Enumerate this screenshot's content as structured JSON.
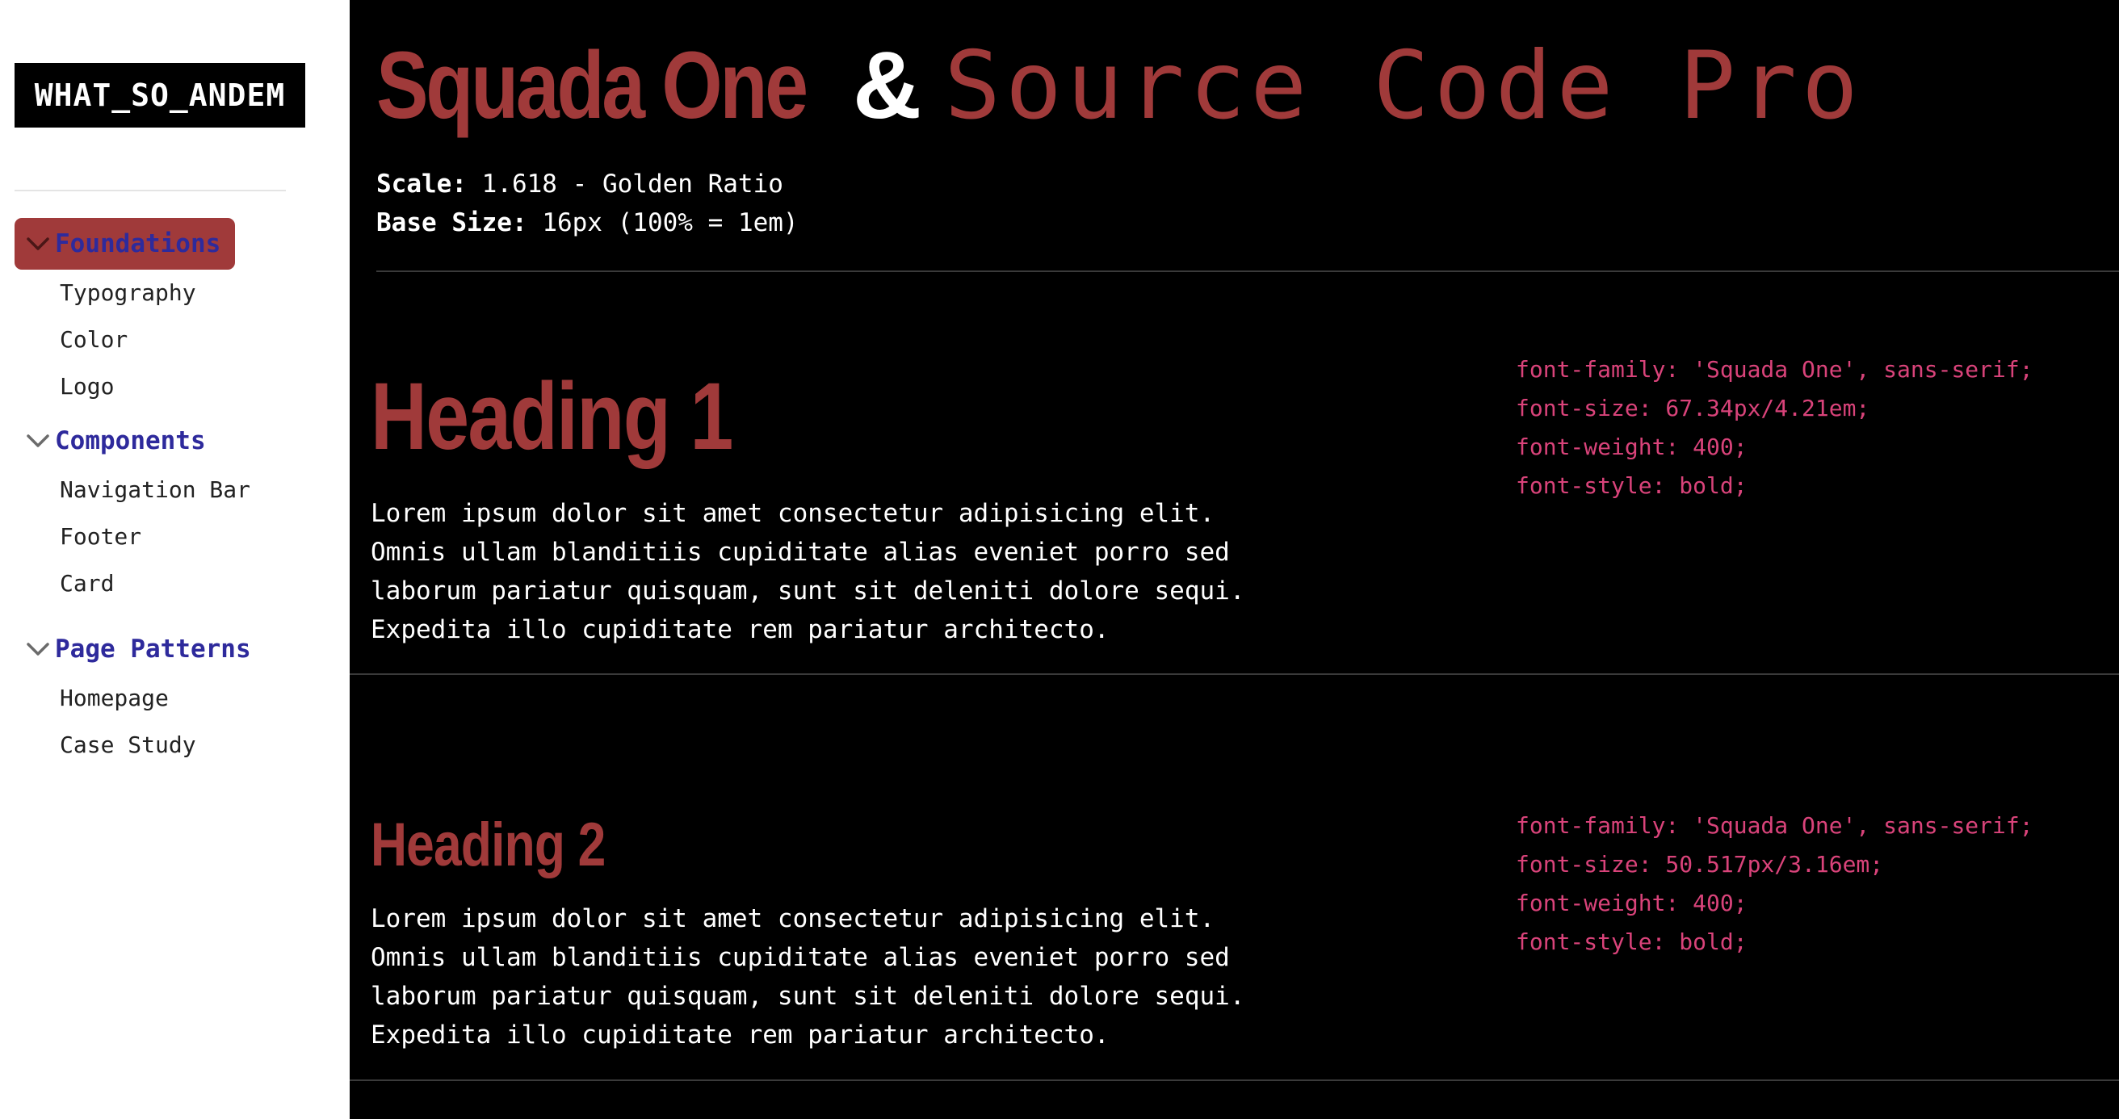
{
  "sidebar": {
    "logo": "WHAT_SO_ANDEM",
    "groups": [
      {
        "label": "Foundations",
        "items": [
          "Typography",
          "Color",
          "Logo"
        ]
      },
      {
        "label": "Components",
        "items": [
          "Navigation Bar",
          "Footer",
          "Card"
        ]
      },
      {
        "label": "Page Patterns",
        "items": [
          "Homepage",
          "Case Study"
        ]
      }
    ]
  },
  "hero": {
    "font_primary": "Squada One",
    "amp": "&",
    "font_secondary": "Source Code Pro"
  },
  "meta": {
    "scale_label": "Scale:",
    "scale_value": "1.618 - Golden Ratio",
    "base_label": "Base Size:",
    "base_value": "16px (100% = 1em)"
  },
  "samples": [
    {
      "heading": "Heading 1",
      "paragraph": [
        "Lorem ipsum dolor sit amet consectetur adipisicing elit.",
        "Omnis ullam blanditiis cupiditate alias eveniet porro sed",
        "laborum pariatur quisquam, sunt sit deleniti dolore sequi.",
        "Expedita illo cupiditate rem pariatur architecto."
      ],
      "css": [
        "font-family: 'Squada One', sans-serif;",
        "font-size: 67.34px/4.21em;",
        "font-weight: 400;",
        "font-style: bold;"
      ]
    },
    {
      "heading": "Heading 2",
      "paragraph": [
        "Lorem ipsum dolor sit amet consectetur adipisicing elit.",
        "Omnis ullam blanditiis cupiditate alias eveniet porro sed",
        "laborum pariatur quisquam, sunt sit deleniti dolore sequi.",
        "Expedita illo cupiditate rem pariatur architecto."
      ],
      "css": [
        "font-family: 'Squada One', sans-serif;",
        "font-size: 50.517px/3.16em;",
        "font-weight: 400;",
        "font-style: bold;"
      ]
    }
  ],
  "colors": {
    "accent": "#a03a3a",
    "nav_text": "#2e2a9c",
    "code": "#d9437a",
    "background_main": "#000000"
  },
  "icons": {
    "group_toggle": "chevron-down-icon"
  }
}
